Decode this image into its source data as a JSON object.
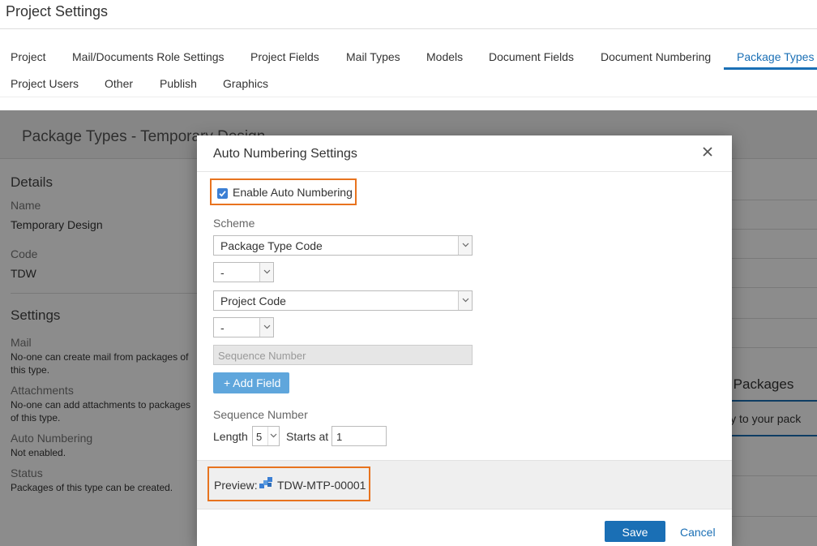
{
  "header": {
    "title": "Project Settings"
  },
  "tabs": [
    {
      "label": "Project"
    },
    {
      "label": "Mail/Documents Role Settings"
    },
    {
      "label": "Project Fields"
    },
    {
      "label": "Mail Types"
    },
    {
      "label": "Models"
    },
    {
      "label": "Document Fields"
    },
    {
      "label": "Document Numbering"
    },
    {
      "label": "Package Types"
    },
    {
      "label": "Project Users"
    },
    {
      "label": "Other"
    },
    {
      "label": "Publish"
    },
    {
      "label": "Graphics"
    }
  ],
  "active_tab": "Package Types",
  "background": {
    "title": "Package Types - Temporary Design",
    "details_heading": "Details",
    "name_label": "Name",
    "name_value": "Temporary Design",
    "code_label": "Code",
    "code_value": "TDW",
    "settings_heading": "Settings",
    "mail_label": "Mail",
    "mail_text": "No-one can create mail from packages of this type.",
    "attachments_label": "Attachments",
    "attachments_text": "No-one can add attachments to packages of this type.",
    "auto_numbering_label": "Auto Numbering",
    "auto_numbering_text": "Not enabled.",
    "status_label": "Status",
    "status_text": "Packages of this type can be created.",
    "right_heading": "gn\" Packages",
    "right_text": "rary to your pack"
  },
  "modal": {
    "title": "Auto Numbering Settings",
    "enable_label": "Enable Auto Numbering",
    "enable_checked": true,
    "scheme_label": "Scheme",
    "scheme_fields": [
      {
        "type": "select",
        "value": "Package Type Code"
      },
      {
        "type": "separator",
        "value": "-"
      },
      {
        "type": "select",
        "value": "Project Code"
      },
      {
        "type": "separator",
        "value": "-"
      }
    ],
    "sequence_placeholder": "Sequence Number",
    "add_field_label": "+ Add Field",
    "sequence_heading": "Sequence Number",
    "length_label": "Length",
    "length_value": "5",
    "starts_label": "Starts at",
    "starts_value": "1",
    "preview_label": "Preview:",
    "preview_value": "TDW-MTP-00001",
    "save_label": "Save",
    "cancel_label": "Cancel"
  },
  "colors": {
    "accent": "#1a6fb5",
    "highlight_border": "#e8731e",
    "add_button": "#5fa6dc"
  }
}
